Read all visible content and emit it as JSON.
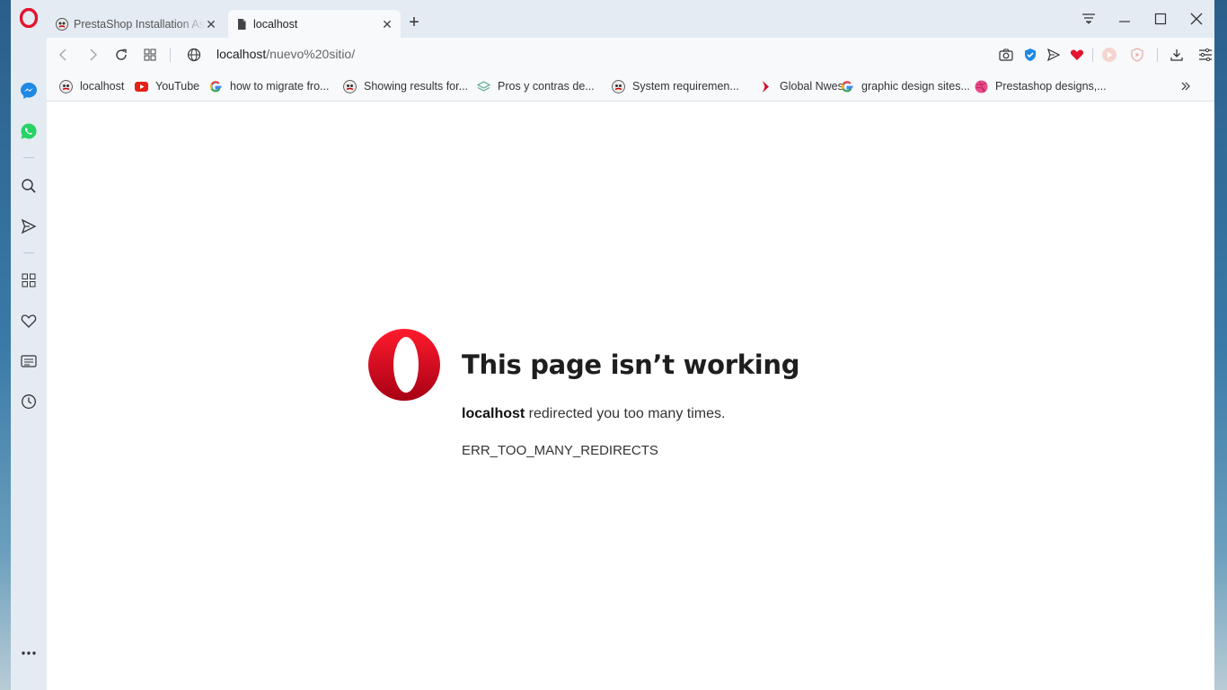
{
  "browser": {
    "tabs": [
      {
        "label": "PrestaShop Installation Assistant",
        "active": false
      },
      {
        "label": "localhost",
        "active": true
      }
    ],
    "new_tab": "+"
  },
  "address": {
    "host": "localhost",
    "path": "/nuevo%20sitio/"
  },
  "bookmarks": [
    {
      "label": "localhost",
      "icon": "prestashop-icon"
    },
    {
      "label": "YouTube",
      "icon": "youtube-icon"
    },
    {
      "label": "how to migrate fro...",
      "icon": "google-icon"
    },
    {
      "label": "Showing results for...",
      "icon": "prestashop-icon"
    },
    {
      "label": "Pros y contras de...",
      "icon": "layers-icon"
    },
    {
      "label": "System requiremen...",
      "icon": "prestashop-icon"
    },
    {
      "label": "Global Nwes",
      "icon": "red-arrow-icon"
    },
    {
      "label": "graphic design sites...",
      "icon": "google-icon"
    },
    {
      "label": "Prestashop designs,...",
      "icon": "dribbble-icon"
    }
  ],
  "error": {
    "title": "This page isn’t working",
    "host": "localhost",
    "message": " redirected you too many times.",
    "code": "ERR_TOO_MANY_REDIRECTS"
  },
  "colors": {
    "opera_red": "#e3142d",
    "chrome_bg": "#e4ebf3",
    "messenger_blue": "#1e88e5",
    "whatsapp_green": "#25d366"
  }
}
